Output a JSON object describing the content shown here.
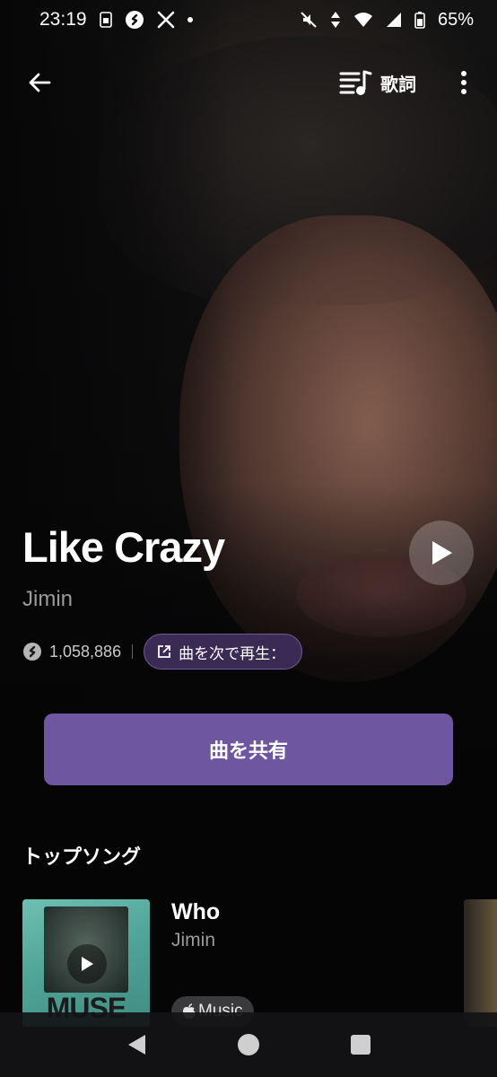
{
  "status_bar": {
    "time": "23:19",
    "battery": "65%",
    "icons": [
      "sim-card-icon",
      "shazam-icon",
      "x-logo-icon",
      "notification-dot-icon",
      "mute-icon",
      "data-arrows-icon",
      "wifi-icon",
      "signal-icon",
      "battery-icon"
    ]
  },
  "app_bar": {
    "back_icon": "arrow-left-icon",
    "lyrics_label": "歌詞",
    "lyrics_icon": "lyrics-list-icon",
    "more_icon": "more-vertical-icon"
  },
  "track": {
    "title": "Like Crazy",
    "artist": "Jimin",
    "shazam_count": "1,058,886",
    "play_next_label": "曲を次で再生：",
    "play_icon": "play-icon"
  },
  "share_button": {
    "label": "曲を共有"
  },
  "top_songs": {
    "title": "トップソング",
    "items": [
      {
        "album_word": "MUSE",
        "title": "Who",
        "artist": "Jimin",
        "badge": "Music"
      }
    ]
  },
  "nav_bar": {
    "icons": [
      "nav-back-icon",
      "nav-home-icon",
      "nav-recents-icon"
    ]
  },
  "colors": {
    "accent": "#6f56a0",
    "chip_bg": "#3a2b55",
    "secondary_text": "#9b9b9b",
    "background": "#050506"
  }
}
